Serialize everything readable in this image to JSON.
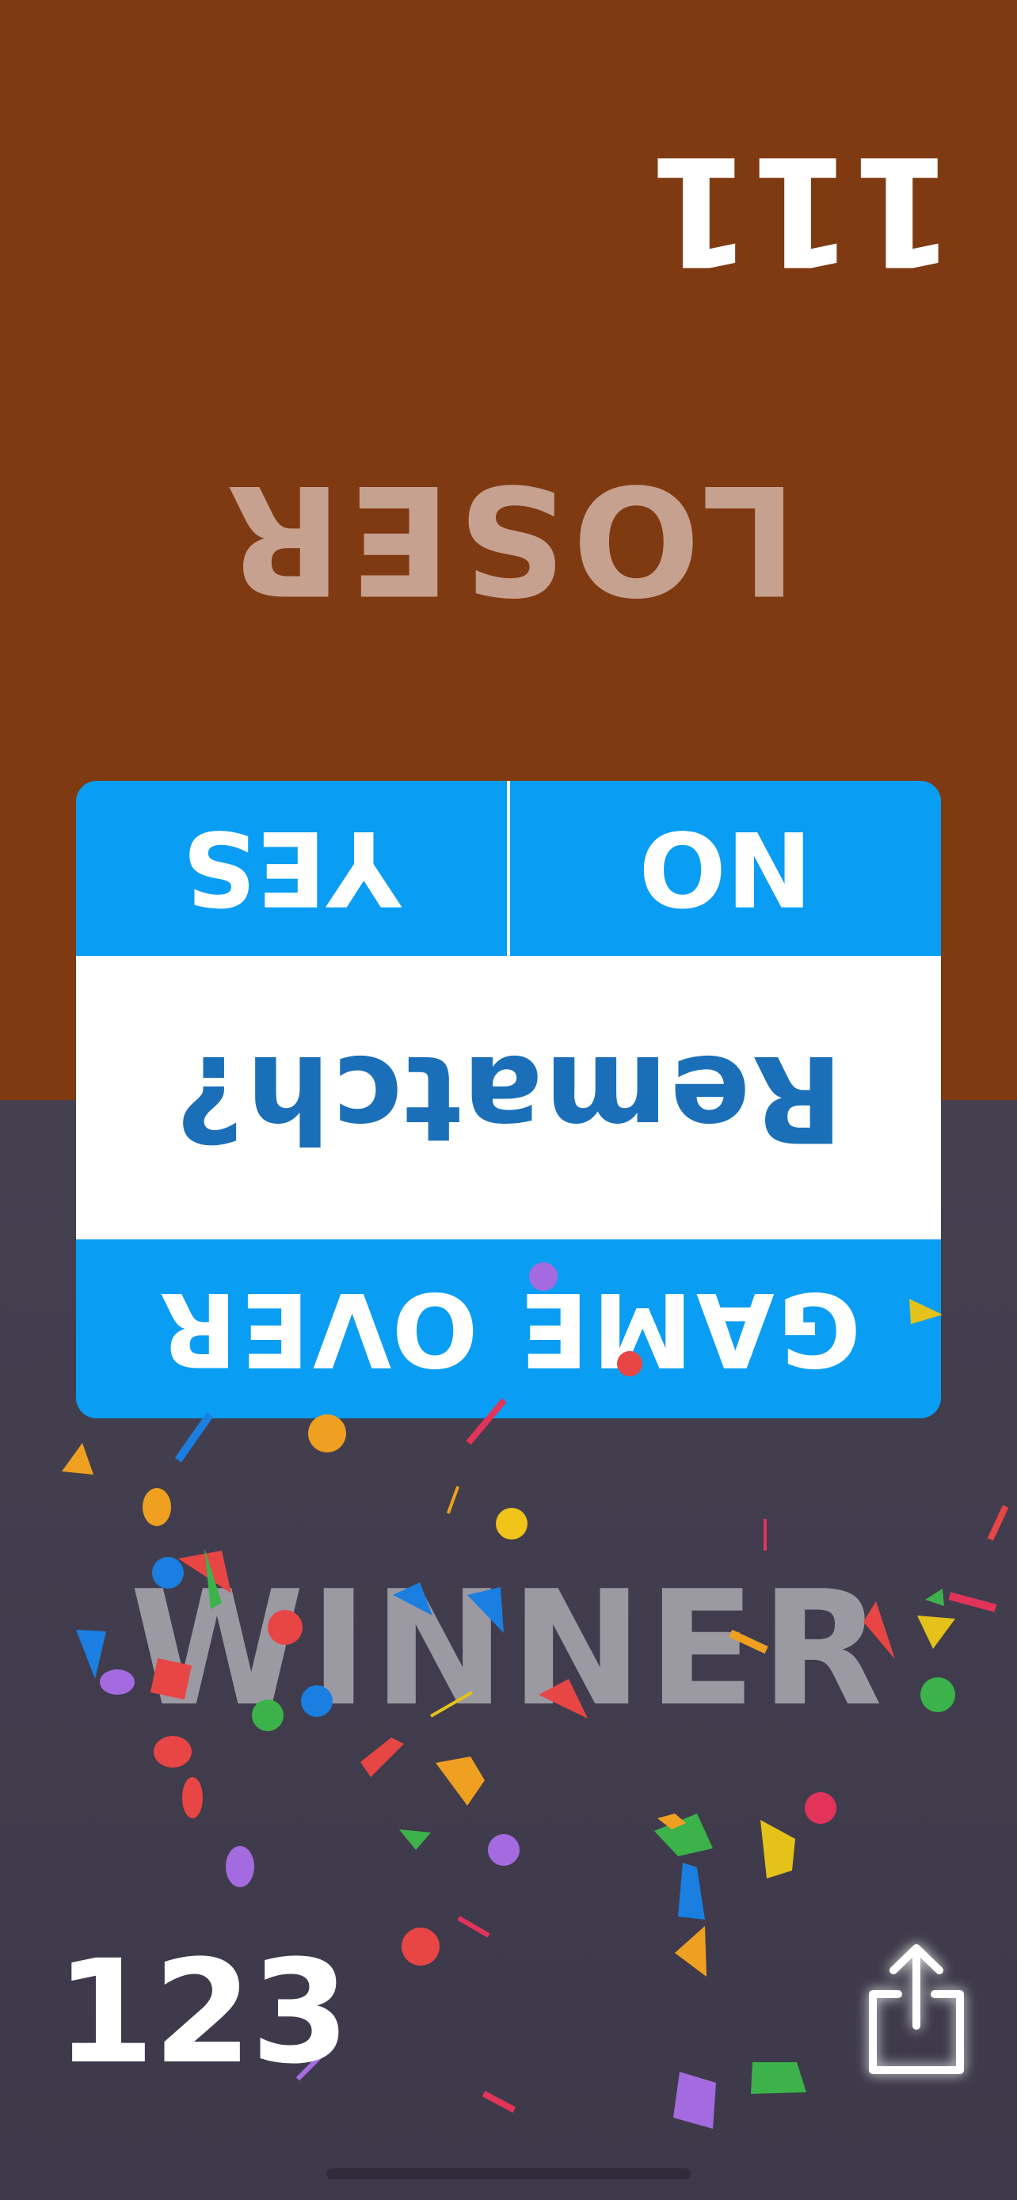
{
  "opponent": {
    "score": "111",
    "status": "LOSER"
  },
  "player": {
    "score": "123",
    "status": "WINNER"
  },
  "dialog": {
    "title": "GAME OVER",
    "question": "Rematch?",
    "left_button": "NO",
    "right_button": "YES"
  },
  "colors": {
    "opponent_bg": "#7f3a12",
    "player_bg": "#3f3a4d",
    "dialog_accent": "#0a9df4",
    "dialog_text": "#1a6fb8"
  },
  "icons": {
    "share": "share-icon"
  }
}
